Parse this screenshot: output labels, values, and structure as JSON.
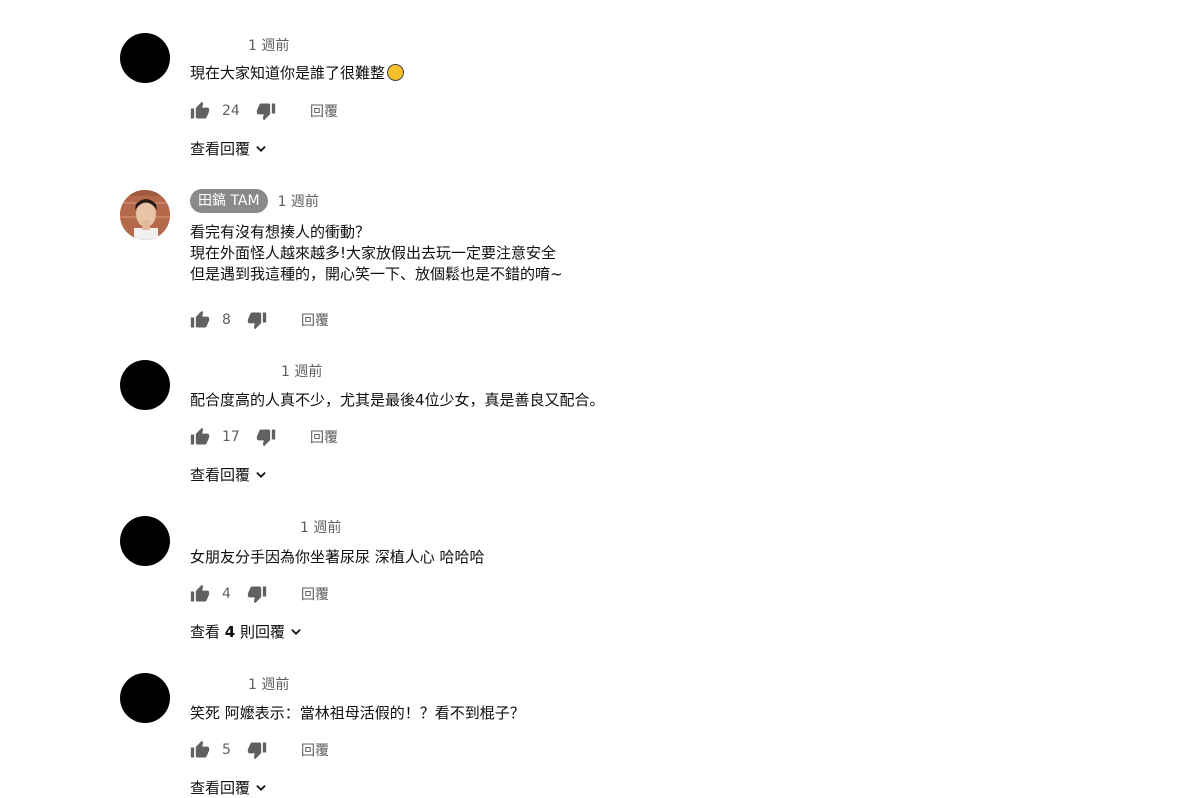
{
  "comments": [
    {
      "author": "",
      "time": "1 週前",
      "text_lines": [
        "現在大家知道你是誰了很難整"
      ],
      "emoji": "grinning-squinting-face",
      "likes": "24",
      "reply_label": "回覆",
      "view_replies": "查看回覆"
    },
    {
      "author": "田鎬 TAM",
      "time": "1 週前",
      "text_lines": [
        "看完有沒有想揍人的衝動？",
        "現在外面怪人越來越多!大家放假出去玩一定要注意安全",
        "但是遇到我這種的，開心笑一下、放個鬆也是不錯的唷~"
      ],
      "likes": "8",
      "reply_label": "回覆"
    },
    {
      "author": "",
      "time": "1 週前",
      "text_lines": [
        "配合度高的人真不少，尤其是最後4位少女，真是善良又配合。"
      ],
      "likes": "17",
      "reply_label": "回覆",
      "view_replies": "查看回覆"
    },
    {
      "author": "",
      "time": "1 週前",
      "text_lines": [
        "女朋友分手因為你坐著尿尿 深植人心 哈哈哈"
      ],
      "likes": "4",
      "reply_label": "回覆",
      "view_replies_prefix": "查看",
      "view_replies_count": "4",
      "view_replies_suffix": "則回覆"
    },
    {
      "author": "",
      "time": "1 週前",
      "text_lines": [
        "笑死 阿嬤表示：當林祖母活假的！？看不到棍子？"
      ],
      "likes": "5",
      "reply_label": "回覆",
      "view_replies": "查看回覆"
    }
  ],
  "icons": {
    "like": "thumb-up-icon",
    "dislike": "thumb-down-icon",
    "expand": "chevron-down-icon"
  },
  "colors": {
    "text": "#0f0f0f",
    "secondary": "#606060",
    "badge": "#8a8a8a"
  }
}
